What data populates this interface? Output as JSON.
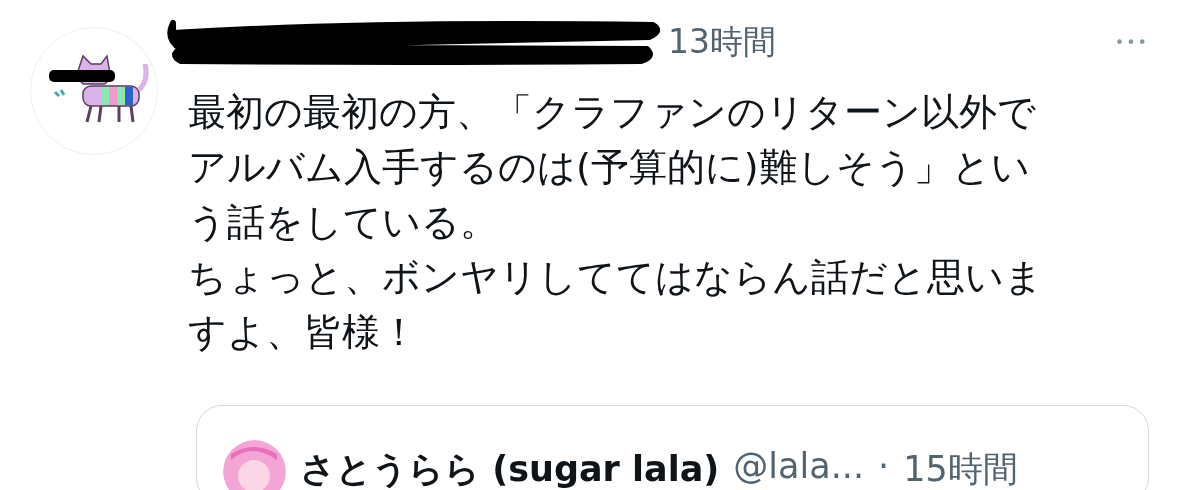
{
  "tweet": {
    "time": "13時間",
    "redacted": true,
    "more": "•••",
    "paragraphs": [
      "最初の最初の方、「クラファンのリターン以外でアルバム入手するのは(予算的に)難しそう」という話をしている。",
      "ちょっと、ボンヤリしててはならん話だと思いますよ、皆様！"
    ],
    "quote": {
      "name": "さとうらら (sugar lala)",
      "handle": "@lala...",
      "separator": "·",
      "time": "15時間"
    }
  }
}
